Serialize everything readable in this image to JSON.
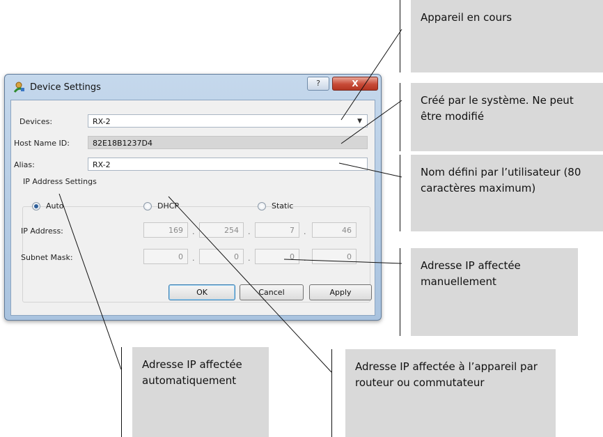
{
  "dialog": {
    "title": "Device Settings",
    "help_label": "?",
    "close_label": "X",
    "devices_label": "Devices:",
    "devices_value": "RX-2",
    "hostname_label": "Host Name ID:",
    "hostname_value": "82E18B1237D4",
    "alias_label": "Alias:",
    "alias_value": "RX-2",
    "ip_group_title": "IP Address Settings",
    "radio_auto": "Auto",
    "radio_dhcp": "DHCP",
    "radio_static": "Static",
    "selected_mode": "Auto",
    "ip_label": "IP Address:",
    "ip_octets": [
      "169",
      "254",
      "7",
      "46"
    ],
    "subnet_label": "Subnet Mask:",
    "subnet_octets": [
      "0",
      "0",
      "0",
      "0"
    ],
    "ok_label": "OK",
    "cancel_label": "Cancel",
    "apply_label": "Apply"
  },
  "callouts": {
    "device": "Appareil en cours",
    "hostname": "Créé par le système. Ne peut être modifié",
    "alias": "Nom défini par l’utilisateur (80 caractères maximum)",
    "static": "Adresse IP affectée manuellement",
    "auto": "Adresse IP affectée automatiquement",
    "dhcp": "Adresse IP affectée à l’appareil par routeur ou commutateur"
  }
}
